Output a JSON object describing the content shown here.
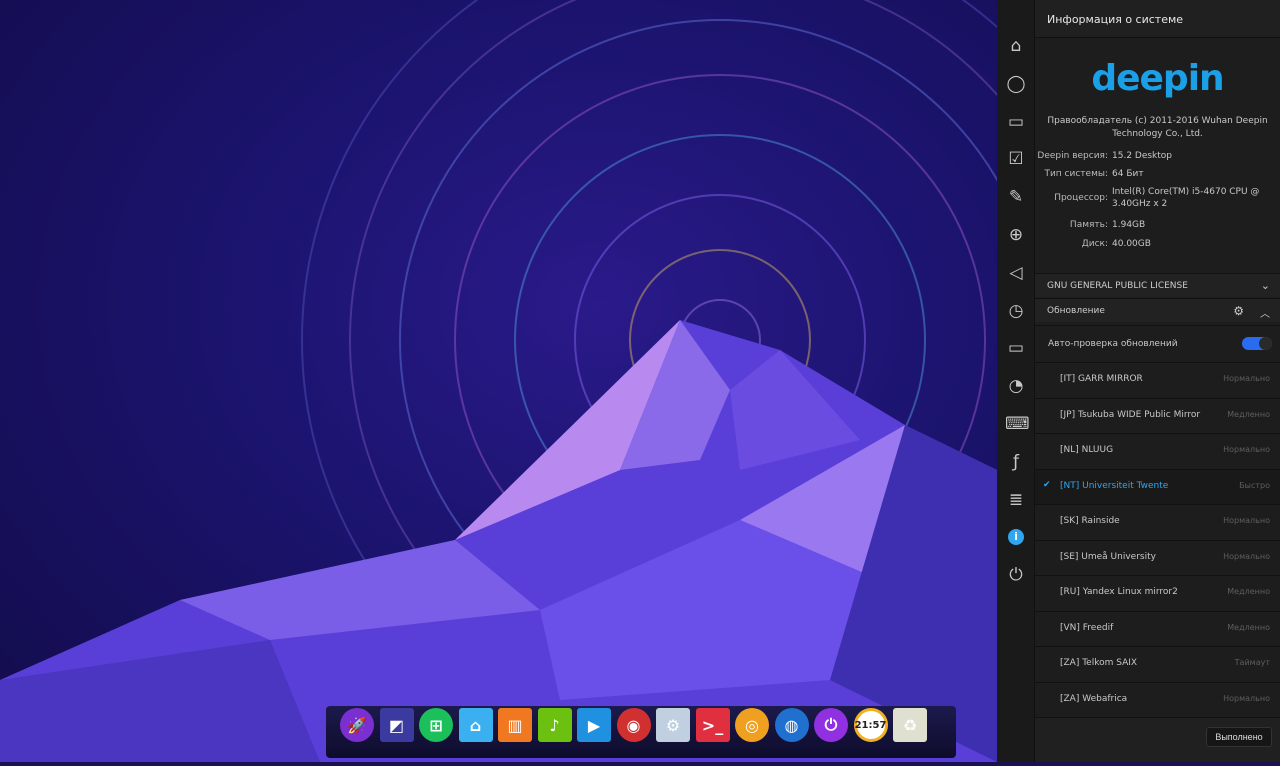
{
  "colors": {
    "accent": "#2ea6f0",
    "logo": "#1ba0e8"
  },
  "dock": [
    {
      "icon": "launcher-rocket-icon",
      "color": "#7b2fd0"
    },
    {
      "icon": "screenshot-icon",
      "color": "#3a3aa0"
    },
    {
      "icon": "store-icon",
      "color": "#1cc05a"
    },
    {
      "icon": "file-manager-icon",
      "color": "#3ab0f0"
    },
    {
      "icon": "shop-bag-icon",
      "color": "#f07820"
    },
    {
      "icon": "music-icon",
      "color": "#6bc010"
    },
    {
      "icon": "video-player-icon",
      "color": "#2090e0"
    },
    {
      "icon": "chrome-icon",
      "color": "#d03030"
    },
    {
      "icon": "settings-gear-icon",
      "color": "#c0d0e0"
    },
    {
      "icon": "terminal-icon",
      "color": "#e03040"
    },
    {
      "icon": "camera-icon",
      "color": "#f0a020"
    },
    {
      "icon": "browser-globe-icon",
      "color": "#2070d0"
    },
    {
      "icon": "power-icon",
      "color": "#9030e0"
    },
    {
      "icon": "clock-icon",
      "color": "#f0b020"
    },
    {
      "icon": "trash-icon",
      "color": "#e0e0d0"
    }
  ],
  "clock_text": "21:57",
  "sidebar": [
    "home-icon",
    "user-icon",
    "display-icon",
    "default-apps-icon",
    "personalization-icon",
    "network-icon",
    "sound-icon",
    "datetime-icon",
    "power-management-icon",
    "mouse-icon",
    "keyboard-icon",
    "fn-key-icon",
    "update-icon",
    "system-info-icon",
    "shutdown-icon"
  ],
  "header": {
    "title": "Информация о системе"
  },
  "logo": "deepin",
  "copyright": "Правообладатель (c) 2011-2016 Wuhan Deepin Technology Co., Ltd.",
  "info": [
    {
      "k": "Deepin версия:",
      "v": "15.2 Desktop"
    },
    {
      "k": "Тип системы:",
      "v": "64 Бит"
    },
    {
      "k": "Процессор:",
      "v": "Intel(R) Core(TM) i5-4670 CPU @ 3.40GHz x 2"
    },
    {
      "k": "Память:",
      "v": "1.94GB"
    },
    {
      "k": "Диск:",
      "v": "40.00GB"
    }
  ],
  "license": "GNU GENERAL PUBLIC LICENSE",
  "update": {
    "title": "Обновление",
    "auto_label": "Авто-проверка обновлений",
    "auto_on": true
  },
  "mirrors": [
    {
      "name": "[IT] GARR MIRROR",
      "speed": "Нормально"
    },
    {
      "name": "[JP] Tsukuba WIDE Public Mirror",
      "speed": "Медленно"
    },
    {
      "name": "[NL] NLUUG",
      "speed": "Нормально"
    },
    {
      "name": "[NT] Universiteit Twente",
      "speed": "Быстро",
      "selected": true
    },
    {
      "name": "[SK] Rainside",
      "speed": "Нормально"
    },
    {
      "name": "[SE] Umeå University",
      "speed": "Нормально"
    },
    {
      "name": "[RU] Yandex Linux mirror2",
      "speed": "Медленно"
    },
    {
      "name": "[VN] Freedif",
      "speed": "Медленно"
    },
    {
      "name": "[ZA] Telkom SAIX",
      "speed": "Таймаут"
    },
    {
      "name": "[ZA] Webafrica",
      "speed": "Нормально"
    }
  ],
  "done_label": "Выполнено"
}
